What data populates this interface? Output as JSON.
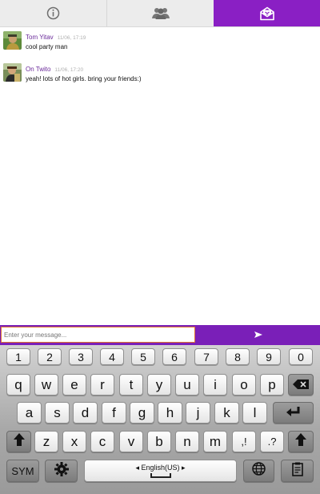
{
  "tabs": [
    {
      "name": "info",
      "icon": "info-icon",
      "active": false
    },
    {
      "name": "people",
      "icon": "group-icon",
      "active": false
    },
    {
      "name": "messages",
      "icon": "mail-open-icon",
      "active": true
    }
  ],
  "colors": {
    "accent": "#8a1fc4",
    "input_border": "#e0762f",
    "author": "#6a2a9a"
  },
  "messages": [
    {
      "author": "Tom Yitav",
      "time": "11/06, 17:19",
      "text": "cool party man",
      "avatar": "avatar-image"
    },
    {
      "author": "On Twito",
      "time": "11/06, 17:20",
      "text": "yeah! lots of hot girls. bring your friends:)",
      "avatar": "avatar-image"
    }
  ],
  "composer": {
    "placeholder": "Enter your message...",
    "send_icon": "send-icon"
  },
  "keyboard": {
    "numbers": [
      "1",
      "2",
      "3",
      "4",
      "5",
      "6",
      "7",
      "8",
      "9",
      "0"
    ],
    "row1": [
      "q",
      "w",
      "e",
      "r",
      "t",
      "y",
      "u",
      "i",
      "o",
      "p"
    ],
    "row2": [
      "a",
      "s",
      "d",
      "f",
      "g",
      "h",
      "j",
      "k",
      "l"
    ],
    "row3": [
      "z",
      "x",
      "c",
      "v",
      "b",
      "n",
      "m"
    ],
    "punct1": ",!",
    "punct2": ".?",
    "sym": "SYM",
    "space_label": "◂ English(US) ▸"
  }
}
